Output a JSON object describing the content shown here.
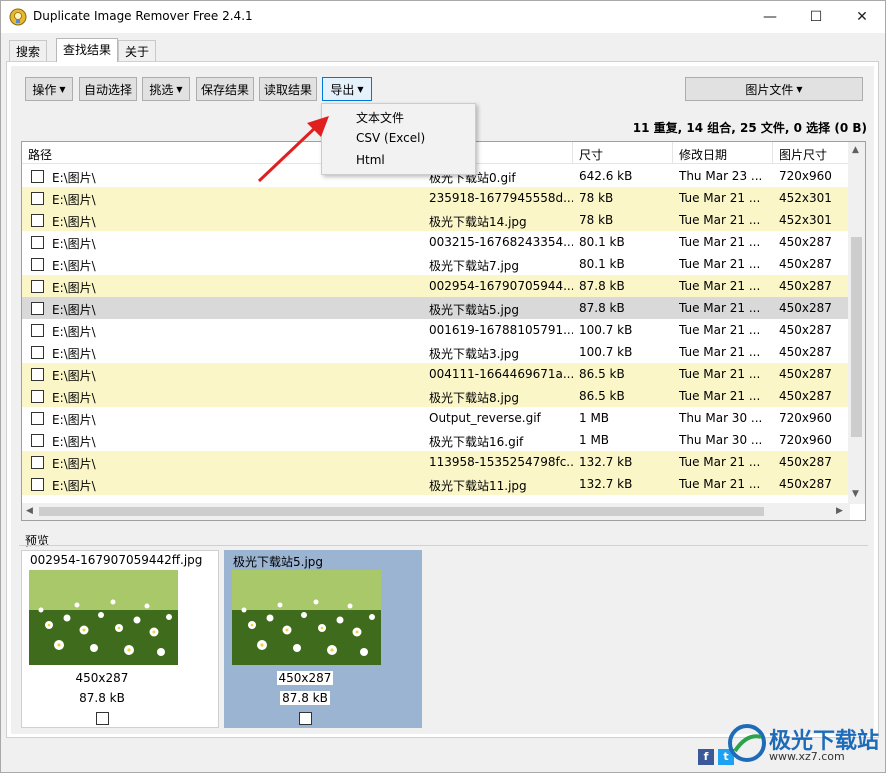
{
  "window": {
    "title": "Duplicate Image Remover Free 2.4.1",
    "minimize": "—",
    "maximize": "☐",
    "close": "✕"
  },
  "tabs": [
    "搜索",
    "查找结果",
    "关于"
  ],
  "toolbar": {
    "operate": "操作",
    "auto_select": "自动选择",
    "pick": "挑选",
    "save_results": "保存结果",
    "load_results": "读取结果",
    "export": "导出",
    "image_files": "图片文件"
  },
  "export_menu": [
    "文本文件",
    "CSV (Excel)",
    "Html"
  ],
  "summary": "11 重复, 14 组合, 25 文件, 0 选择 (0 B)",
  "grid": {
    "headers": [
      "路径",
      "",
      "尺寸",
      "修改日期",
      "图片尺寸"
    ],
    "rows": [
      {
        "path": "E:\\图片\\",
        "name": "极光下载站0.gif",
        "size": "642.6 kB",
        "date": "Thu Mar 23 ...",
        "dims": "720x960",
        "style": "plain"
      },
      {
        "path": "E:\\图片\\",
        "name": "235918-1677945558d...",
        "size": "78 kB",
        "date": "Tue Mar 21 ...",
        "dims": "452x301",
        "style": "hl"
      },
      {
        "path": "E:\\图片\\",
        "name": "极光下载站14.jpg",
        "size": "78 kB",
        "date": "Tue Mar 21 ...",
        "dims": "452x301",
        "style": "hl"
      },
      {
        "path": "E:\\图片\\",
        "name": "003215-16768243354...",
        "size": "80.1 kB",
        "date": "Tue Mar 21 ...",
        "dims": "450x287",
        "style": "plain"
      },
      {
        "path": "E:\\图片\\",
        "name": "极光下载站7.jpg",
        "size": "80.1 kB",
        "date": "Tue Mar 21 ...",
        "dims": "450x287",
        "style": "plain"
      },
      {
        "path": "E:\\图片\\",
        "name": "002954-16790705944...",
        "size": "87.8 kB",
        "date": "Tue Mar 21 ...",
        "dims": "450x287",
        "style": "hl"
      },
      {
        "path": "E:\\图片\\",
        "name": "极光下载站5.jpg",
        "size": "87.8 kB",
        "date": "Tue Mar 21 ...",
        "dims": "450x287",
        "style": "sel"
      },
      {
        "path": "E:\\图片\\",
        "name": "001619-16788105791...",
        "size": "100.7 kB",
        "date": "Tue Mar 21 ...",
        "dims": "450x287",
        "style": "plain"
      },
      {
        "path": "E:\\图片\\",
        "name": "极光下载站3.jpg",
        "size": "100.7 kB",
        "date": "Tue Mar 21 ...",
        "dims": "450x287",
        "style": "plain"
      },
      {
        "path": "E:\\图片\\",
        "name": "004111-1664469671a...",
        "size": "86.5 kB",
        "date": "Tue Mar 21 ...",
        "dims": "450x287",
        "style": "hl"
      },
      {
        "path": "E:\\图片\\",
        "name": "极光下载站8.jpg",
        "size": "86.5 kB",
        "date": "Tue Mar 21 ...",
        "dims": "450x287",
        "style": "hl"
      },
      {
        "path": "E:\\图片\\",
        "name": "Output_reverse.gif",
        "size": "1 MB",
        "date": "Thu Mar 30 ...",
        "dims": "720x960",
        "style": "plain"
      },
      {
        "path": "E:\\图片\\",
        "name": "极光下载站16.gif",
        "size": "1 MB",
        "date": "Thu Mar 30 ...",
        "dims": "720x960",
        "style": "plain"
      },
      {
        "path": "E:\\图片\\",
        "name": "113958-1535254798fc...",
        "size": "132.7 kB",
        "date": "Tue Mar 21 ...",
        "dims": "450x287",
        "style": "hl"
      },
      {
        "path": "E:\\图片\\",
        "name": "极光下载站11.jpg",
        "size": "132.7 kB",
        "date": "Tue Mar 21 ...",
        "dims": "450x287",
        "style": "hl"
      }
    ]
  },
  "preview": {
    "label": "预览",
    "cards": [
      {
        "name": "002954-167907059442ff.jpg",
        "dims": "450x287",
        "size": "87.8 kB"
      },
      {
        "name": "极光下载站5.jpg",
        "dims": "450x287",
        "size": "87.8 kB"
      }
    ]
  },
  "watermark": {
    "title": "极光下载站",
    "url": "www.xz7.com"
  }
}
